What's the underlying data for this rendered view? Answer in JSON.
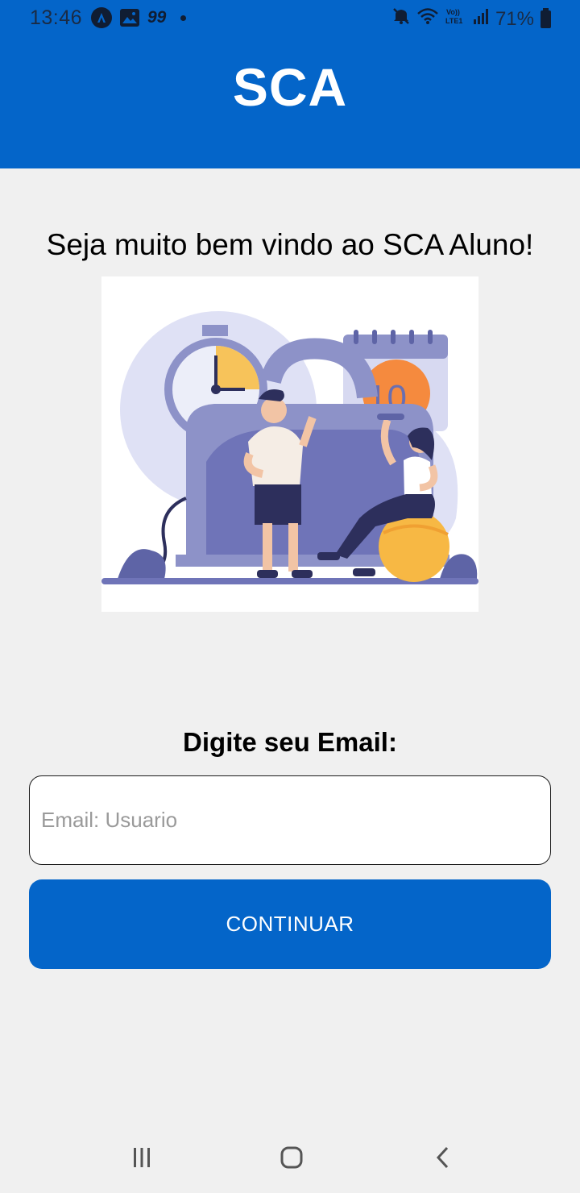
{
  "status_bar": {
    "time": "13:46",
    "badge_text": "99",
    "battery_percent": "71%",
    "icons": [
      "a-circle-icon",
      "image-icon",
      "mute-icon",
      "wifi-icon",
      "volte-icon",
      "signal-icon",
      "battery-icon"
    ]
  },
  "header": {
    "title": "SCA",
    "background_color": "#0465c9"
  },
  "main": {
    "welcome_text": "Seja muito bem vindo ao SCA Aluno!",
    "hero_image": "fitness-illustration",
    "email_label": "Digite seu Email:",
    "email_input": {
      "value": "",
      "placeholder": "Email: Usuario"
    },
    "continue_button": {
      "label": "CONTINUAR",
      "color": "#0465c9"
    }
  },
  "nav_bar": {
    "icons": [
      "recents-icon",
      "home-icon",
      "back-icon"
    ]
  }
}
